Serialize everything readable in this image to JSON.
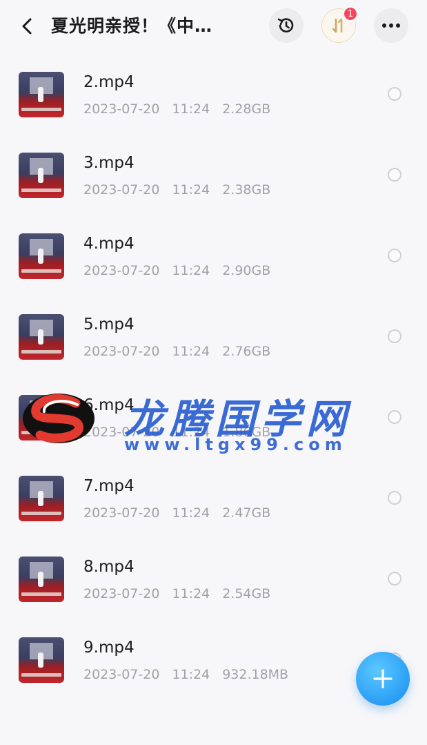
{
  "header": {
    "title": "夏光明亲授！《中…",
    "history_icon": "history-icon",
    "transfer_icon": "transfer-icon",
    "transfer_badge": "1",
    "more_icon": "more-icon"
  },
  "files": [
    {
      "name": "2.mp4",
      "date": "2023-07-20",
      "time": "11:24",
      "size": "2.28GB"
    },
    {
      "name": "3.mp4",
      "date": "2023-07-20",
      "time": "11:24",
      "size": "2.38GB"
    },
    {
      "name": "4.mp4",
      "date": "2023-07-20",
      "time": "11:24",
      "size": "2.90GB"
    },
    {
      "name": "5.mp4",
      "date": "2023-07-20",
      "time": "11:24",
      "size": "2.76GB"
    },
    {
      "name": "6.mp4",
      "date": "2023-07-20",
      "time": "11:24",
      "size": "1.86GB"
    },
    {
      "name": "7.mp4",
      "date": "2023-07-20",
      "time": "11:24",
      "size": "2.47GB"
    },
    {
      "name": "8.mp4",
      "date": "2023-07-20",
      "time": "11:24",
      "size": "2.54GB"
    },
    {
      "name": "9.mp4",
      "date": "2023-07-20",
      "time": "11:24",
      "size": "932.18MB"
    }
  ],
  "watermark": {
    "text": "龙腾国学网",
    "url": "www.ltgx99.com"
  },
  "fab": {
    "icon": "plus-icon"
  },
  "colors": {
    "accent": "#2a9ef5",
    "badge": "#f5455c",
    "watermark": "#2b5fd0"
  }
}
